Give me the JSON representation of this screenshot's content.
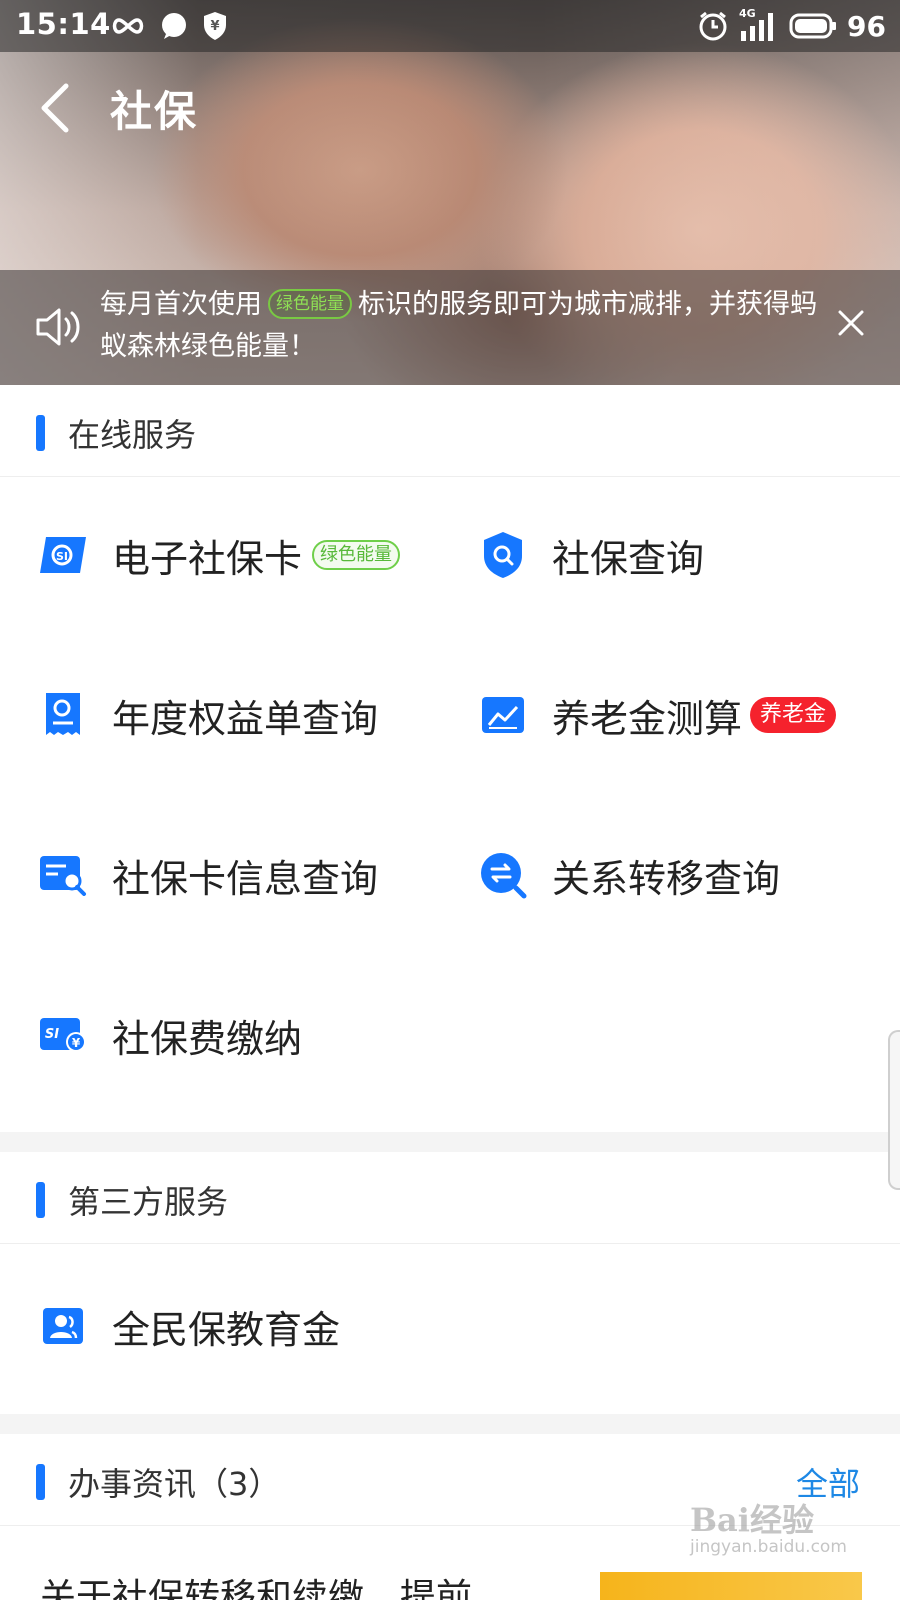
{
  "status_bar": {
    "time": "15:14",
    "network": "4G",
    "battery": "96"
  },
  "header": {
    "title": "社保"
  },
  "notice": {
    "text_before": "每月首次使用",
    "badge": "绿色能量",
    "text_after": "标识的服务即可为城市减排，并获得蚂蚁森林绿色能量！"
  },
  "online_services": {
    "title": "在线服务",
    "items": [
      {
        "label": "电子社保卡",
        "badge": "绿色能量"
      },
      {
        "label": "社保查询"
      },
      {
        "label": "年度权益单查询"
      },
      {
        "label": "养老金测算",
        "badge": "养老金"
      },
      {
        "label": "社保卡信息查询"
      },
      {
        "label": "关系转移查询"
      },
      {
        "label": "社保费缴纳"
      }
    ]
  },
  "third_party": {
    "title": "第三方服务",
    "items": [
      {
        "label": "全民保教育金"
      }
    ]
  },
  "news": {
    "title": "办事资讯（3）",
    "more": "全部",
    "first_item_title": "关于社保转移和续缴，提前"
  },
  "watermark": {
    "brand": "Bai经验",
    "url": "jingyan.baidu.com"
  },
  "colors": {
    "accent": "#1677ff",
    "green_badge": "#58b93a",
    "red_badge": "#f5222d",
    "link": "#1e88e5"
  }
}
